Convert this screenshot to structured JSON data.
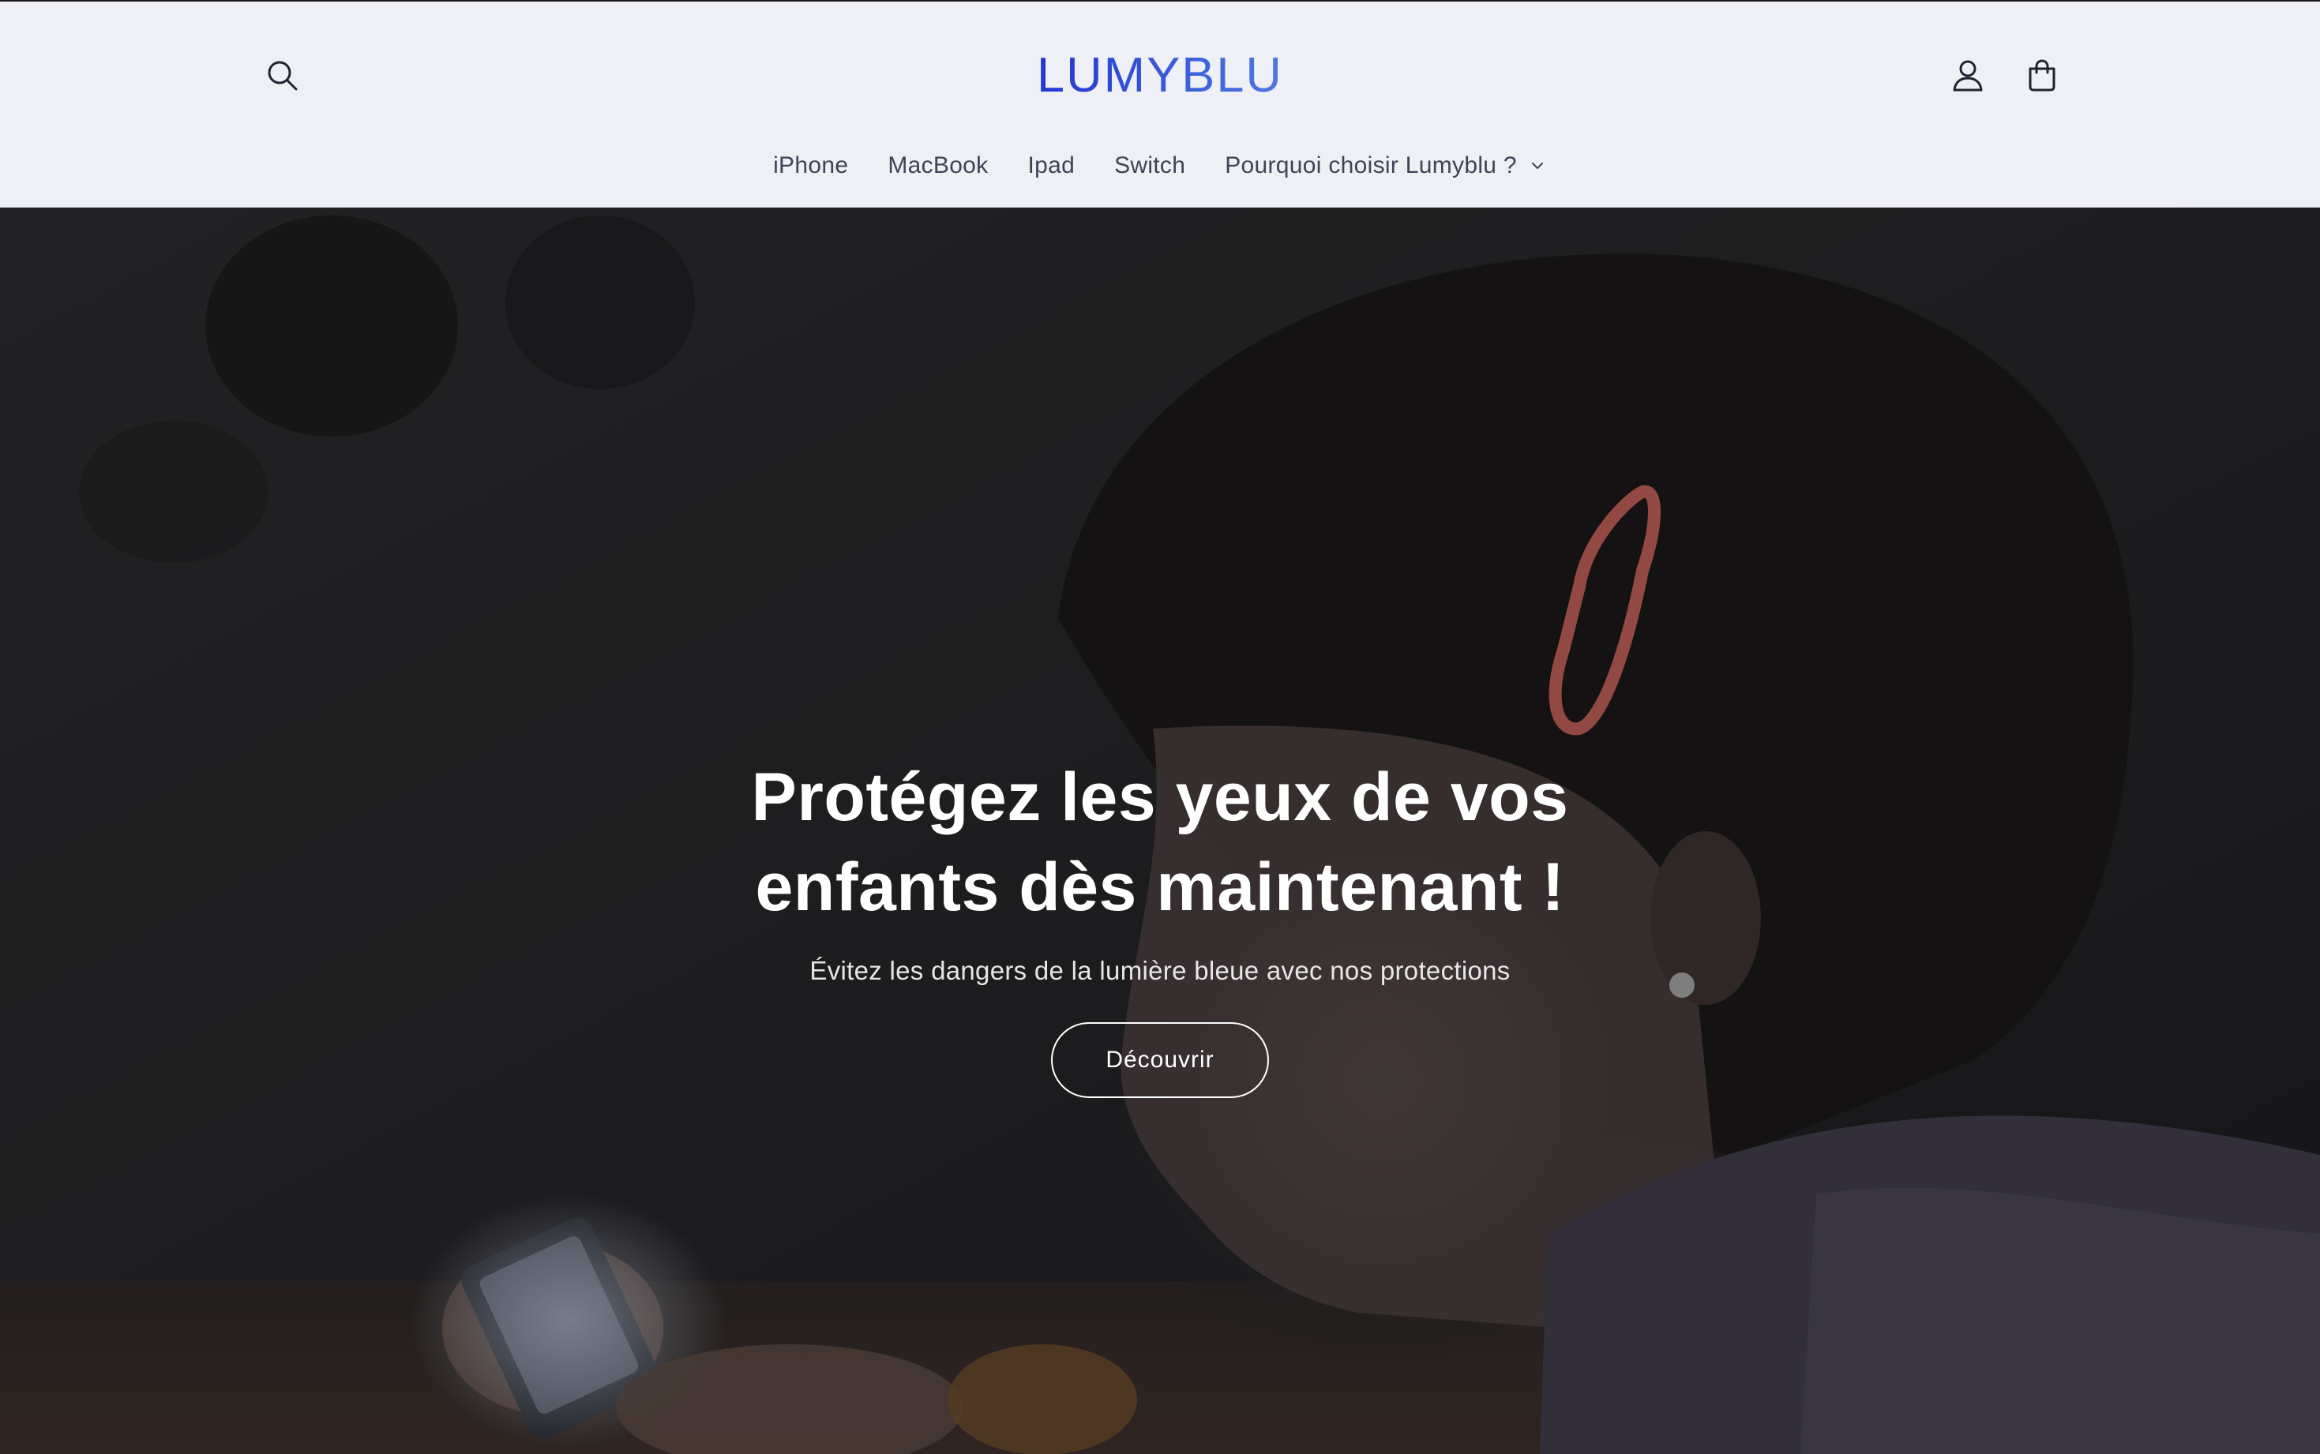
{
  "header": {
    "logo_text": "LUMYBLU",
    "search_icon": "search-icon",
    "account_icon": "user-icon",
    "cart_icon": "shopping-bag-icon"
  },
  "nav": {
    "items": [
      {
        "label": "iPhone"
      },
      {
        "label": "MacBook"
      },
      {
        "label": "Ipad"
      },
      {
        "label": "Switch"
      },
      {
        "label": "Pourquoi choisir Lumyblu ?",
        "has_dropdown": true
      }
    ]
  },
  "hero": {
    "title_line1": "Protégez les yeux de vos",
    "title_line2": "enfants dès maintenant !",
    "subtitle": "Évitez les dangers de la lumière bleue avec nos protections",
    "button_label": "Découvrir"
  },
  "colors": {
    "header_bg": "#eef0f5",
    "logo_blue_start": "#2a3fd6",
    "logo_blue_end": "#4d7ae0",
    "nav_text": "#3c4456",
    "hero_bg": "#1e1d21",
    "hero_text": "#ffffff"
  }
}
